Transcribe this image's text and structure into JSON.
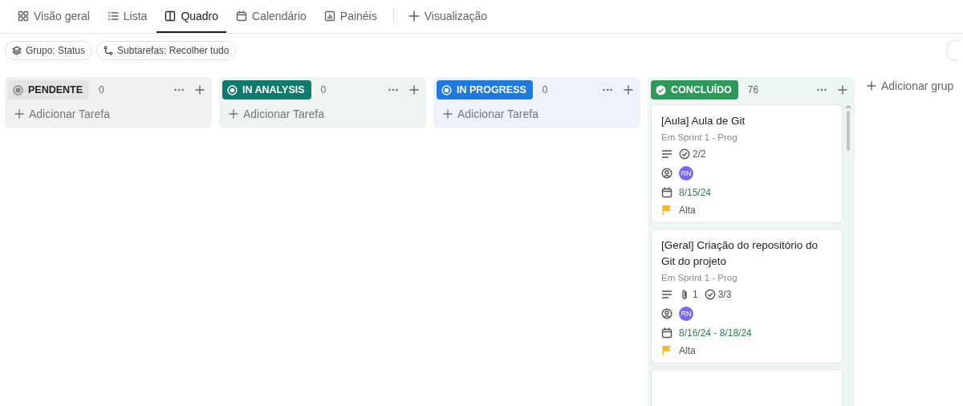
{
  "tabs": [
    {
      "label": "Visão geral",
      "selected": false
    },
    {
      "label": "Lista",
      "selected": false
    },
    {
      "label": "Quadro",
      "selected": true
    },
    {
      "label": "Calendário",
      "selected": false
    },
    {
      "label": "Painéis",
      "selected": false
    }
  ],
  "add_view": {
    "label": "Visualização"
  },
  "filters": [
    {
      "label": "Grupo: Status"
    },
    {
      "label": "Subtarefas: Recolher tudo"
    }
  ],
  "columns": [
    {
      "status": "PENDENTE",
      "kind": "todo",
      "color": "#e4e4e4",
      "count": "0",
      "add_task": "Adicionar Tarefa"
    },
    {
      "status": "IN ANALYSIS",
      "kind": "active",
      "color": "#0f7b6c",
      "count": "0",
      "add_task": "Adicionar Tarefa"
    },
    {
      "status": "IN PROGRESS",
      "kind": "active",
      "color": "#1f7ae0",
      "count": "0",
      "add_task": "Adicionar Tarefa"
    },
    {
      "status": "CONCLUÍDO",
      "kind": "done",
      "color": "#2d9a5b",
      "count": "76",
      "cards": [
        {
          "kind": "task",
          "title": "[Aula] Aula de Git",
          "location": "Em Sprint 1 - Prog",
          "checklist": "2/2",
          "assignee": "RN",
          "date": "8/15/24",
          "priority": "Alta"
        },
        {
          "kind": "task",
          "title": "[Geral] Criação do repositório do Git do projeto",
          "location": "Em Sprint 1 - Prog",
          "attachments": "1",
          "checklist": "3/3",
          "assignee": "RN",
          "date": "8/16/24 - 8/18/24",
          "priority": "Alta"
        },
        {
          "kind": "partial"
        }
      ]
    }
  ],
  "add_group": {
    "label": "Adicionar grup"
  }
}
